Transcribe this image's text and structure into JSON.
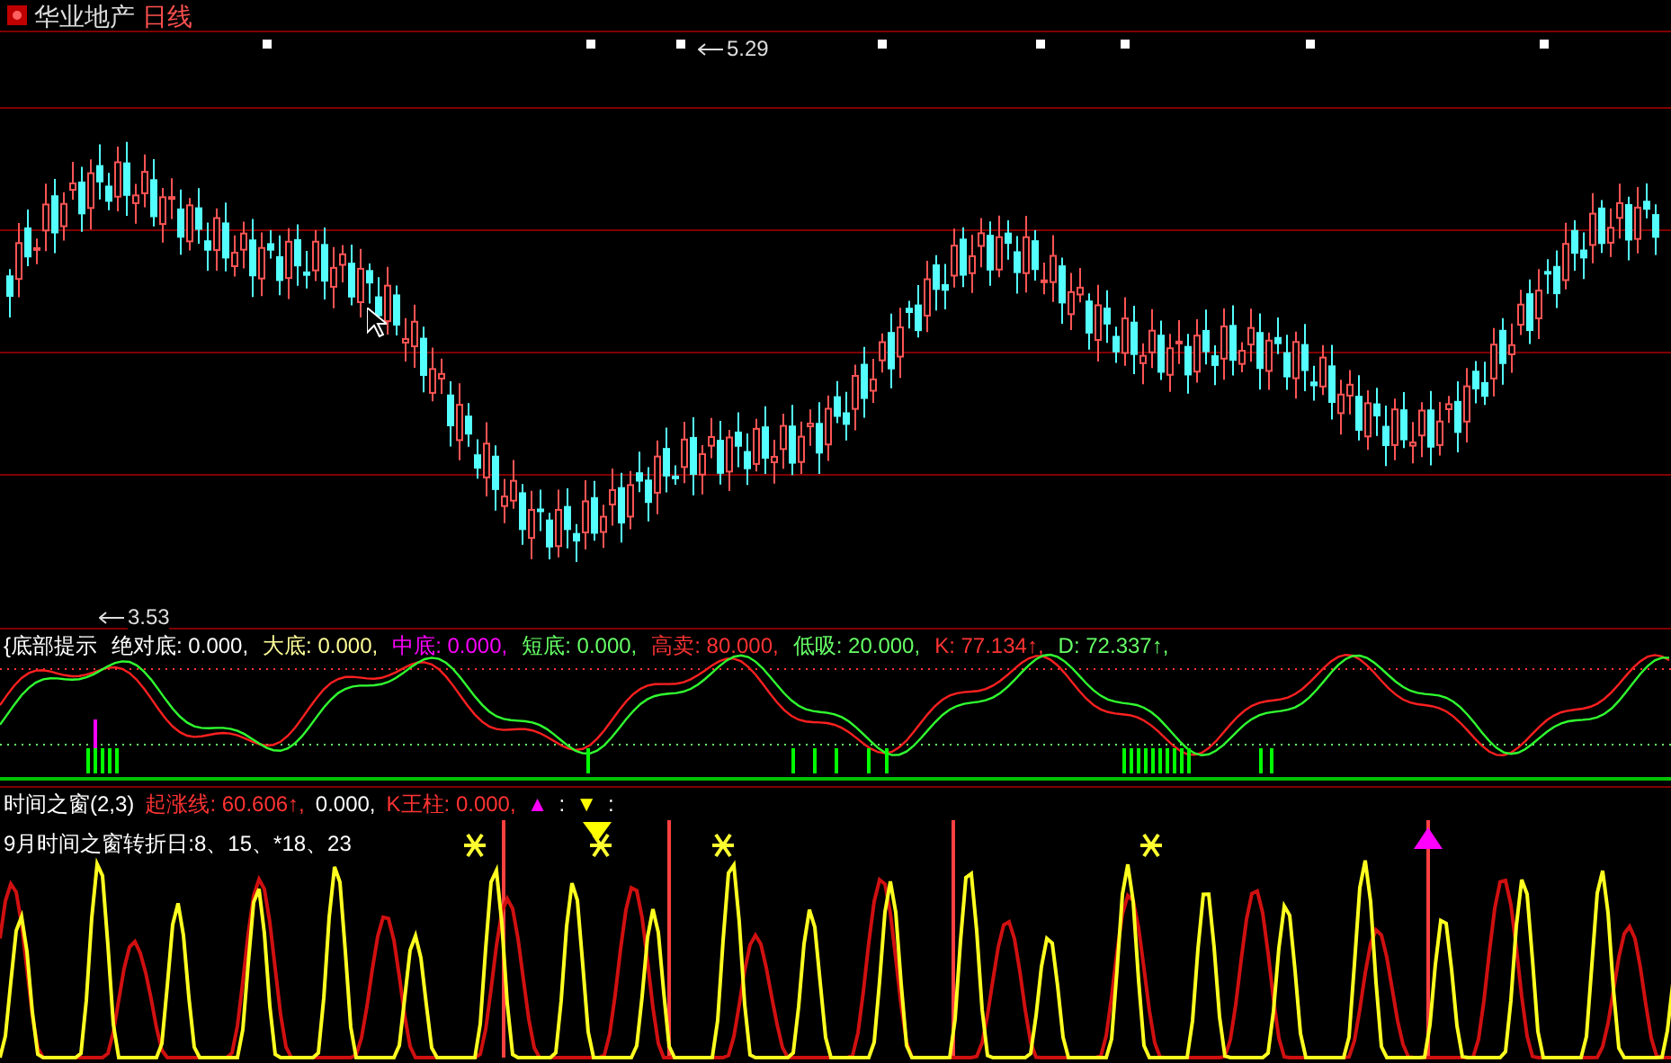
{
  "title": {
    "stock": "华业地产",
    "period": "日线"
  },
  "price_labels": [
    {
      "text": "5.29",
      "kind": "high"
    },
    {
      "text": "3.53",
      "kind": "low"
    }
  ],
  "indicator_1": {
    "items": [
      {
        "text": "{底部提示",
        "color": "#ffffff"
      },
      {
        "text": "绝对底: 0.000,",
        "color": "#ffffff"
      },
      {
        "text": "大底: 0.000,",
        "color": "#ffff99"
      },
      {
        "text": "中底: 0.000,",
        "color": "#ff00ff"
      },
      {
        "text": "短底: 0.000,",
        "color": "#66ff66"
      },
      {
        "text": "高卖: 80.000,",
        "color": "#ff3333"
      },
      {
        "text": "低吸: 20.000,",
        "color": "#66ff66"
      },
      {
        "text": "K: 77.134↑,",
        "color": "#ff3333"
      },
      {
        "text": "D: 72.337↑,",
        "color": "#66ff66"
      }
    ]
  },
  "indicator_2": {
    "items": [
      {
        "text": "时间之窗(2,3)",
        "color": "#ffffff"
      },
      {
        "text": "起涨线: 60.606↑,",
        "color": "#ff3333"
      },
      {
        "text": "0.000,",
        "color": "#ffffff"
      },
      {
        "text": "K王柱: 0.000,",
        "color": "#ff3333"
      },
      {
        "text": "▲",
        "color": "#ff00ff"
      },
      {
        "text": ":",
        "color": "#ffffff"
      },
      {
        "text": "▼",
        "color": "#ffff00"
      },
      {
        "text": ":",
        "color": "#ffffff"
      }
    ],
    "note": "9月时间之窗转折日:8、15、*18、23"
  }
}
